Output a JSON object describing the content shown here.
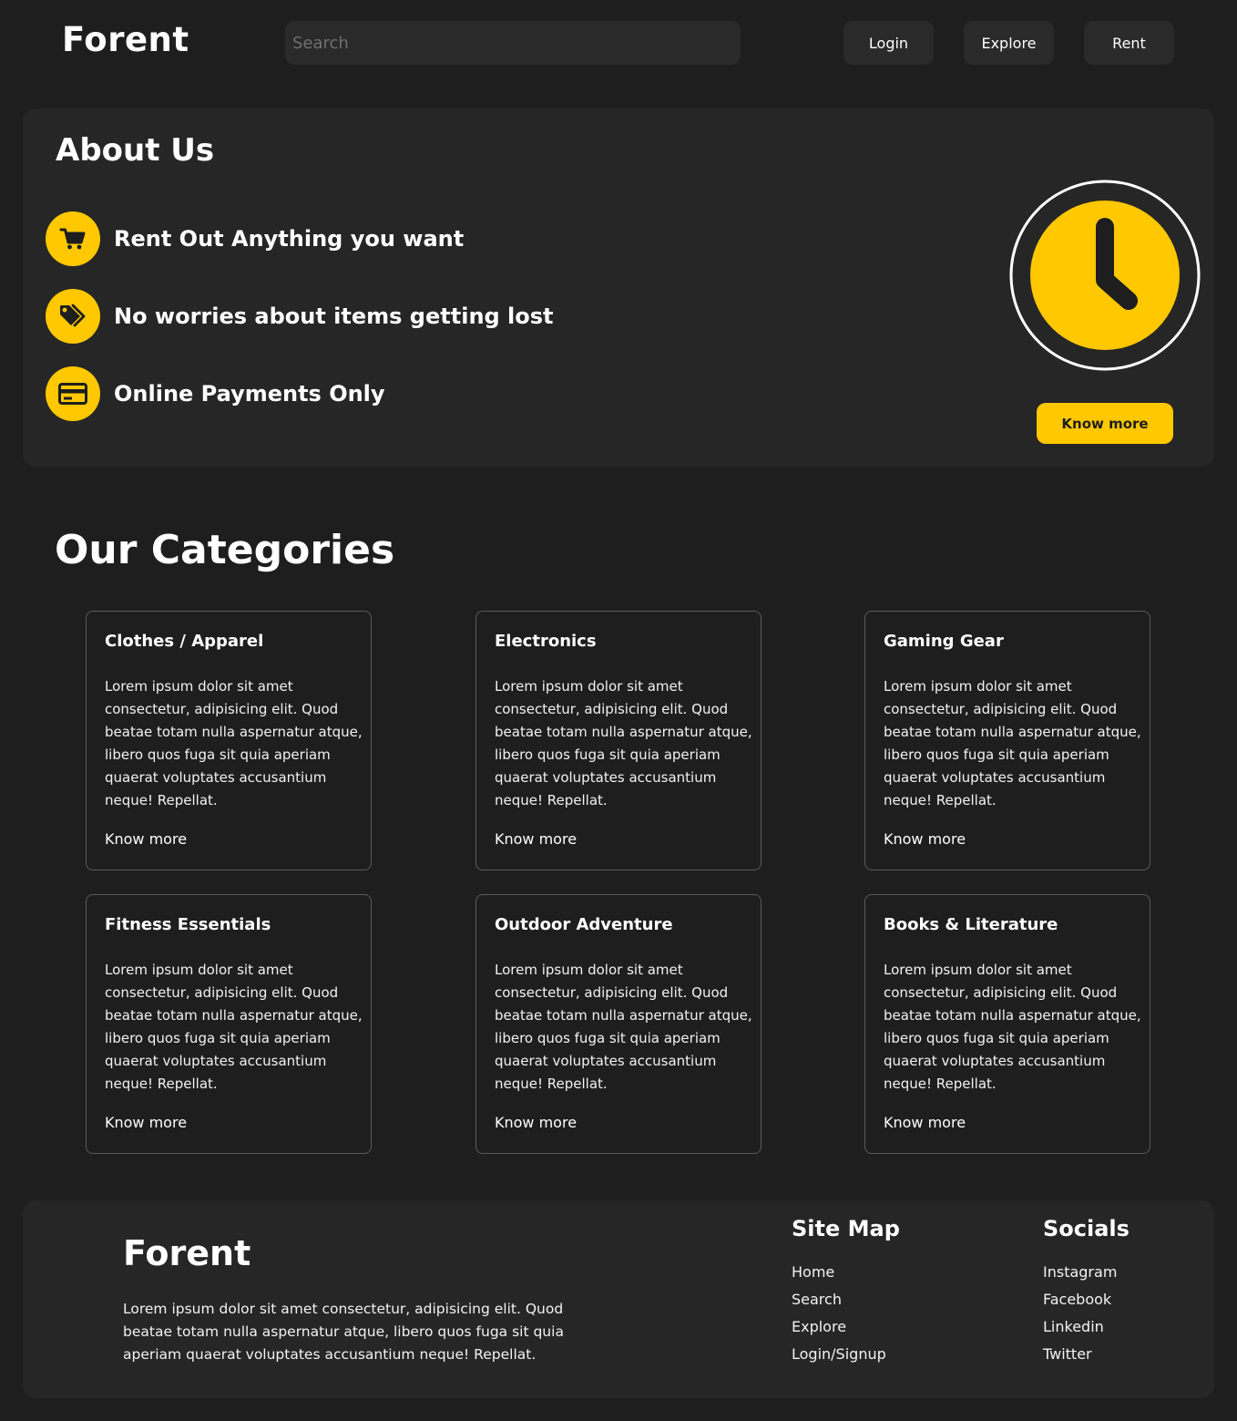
{
  "header": {
    "brand": "Forent",
    "search_placeholder": "Search",
    "nav": {
      "login": "Login",
      "explore": "Explore",
      "rent": "Rent"
    }
  },
  "about": {
    "title": "About Us",
    "features": [
      {
        "icon": "cart-icon",
        "text": "Rent Out Anything you want"
      },
      {
        "icon": "tag-icon",
        "text": "No worries about items getting lost"
      },
      {
        "icon": "credit-card-icon",
        "text": "Online Payments Only"
      }
    ],
    "illustration_icon": "clock-icon",
    "cta_label": "Know more"
  },
  "categories": {
    "title": "Our Categories",
    "items": [
      {
        "title": "Clothes / Apparel",
        "body": "Lorem ipsum dolor sit amet consectetur, adipisicing elit. Quod beatae totam nulla aspernatur atque, libero quos fuga sit quia aperiam quaerat voluptates accusantium neque! Repellat.",
        "link": "Know more"
      },
      {
        "title": "Electronics",
        "body": "Lorem ipsum dolor sit amet consectetur, adipisicing elit. Quod beatae totam nulla aspernatur atque, libero quos fuga sit quia aperiam quaerat voluptates accusantium neque! Repellat.",
        "link": "Know more"
      },
      {
        "title": "Gaming Gear",
        "body": "Lorem ipsum dolor sit amet consectetur, adipisicing elit. Quod beatae totam nulla aspernatur atque, libero quos fuga sit quia aperiam quaerat voluptates accusantium neque! Repellat.",
        "link": "Know more"
      },
      {
        "title": "Fitness Essentials",
        "body": "Lorem ipsum dolor sit amet consectetur, adipisicing elit. Quod beatae totam nulla aspernatur atque, libero quos fuga sit quia aperiam quaerat voluptates accusantium neque! Repellat.",
        "link": "Know more"
      },
      {
        "title": "Outdoor Adventure",
        "body": "Lorem ipsum dolor sit amet consectetur, adipisicing elit. Quod beatae totam nulla aspernatur atque, libero quos fuga sit quia aperiam quaerat voluptates accusantium neque! Repellat.",
        "link": "Know more"
      },
      {
        "title": "Books & Literature",
        "body": "Lorem ipsum dolor sit amet consectetur, adipisicing elit. Quod beatae totam nulla aspernatur atque, libero quos fuga sit quia aperiam quaerat voluptates accusantium neque! Repellat.",
        "link": "Know more"
      }
    ]
  },
  "footer": {
    "brand": "Forent",
    "description": "Lorem ipsum dolor sit amet consectetur, adipisicing elit. Quod beatae totam nulla aspernatur atque, libero quos fuga sit quia aperiam quaerat voluptates accusantium neque! Repellat.",
    "sitemap": {
      "title": "Site Map",
      "links": [
        "Home",
        "Search",
        "Explore",
        "Login/Signup"
      ]
    },
    "socials": {
      "title": "Socials",
      "links": [
        "Instagram",
        "Facebook",
        "Linkedin",
        "Twitter"
      ]
    }
  },
  "colors": {
    "background": "#1e1e1e",
    "panel": "#262626",
    "accent": "#ffc800",
    "text": "#ffffff"
  }
}
